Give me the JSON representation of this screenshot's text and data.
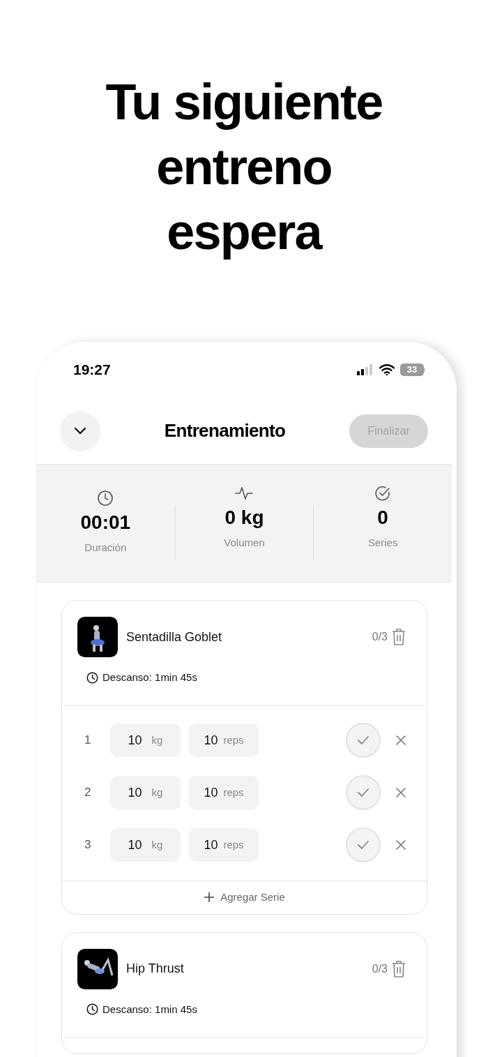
{
  "headline": "Tu siguiente entreno espera",
  "status_bar": {
    "time": "19:27",
    "battery": "33"
  },
  "header": {
    "title": "Entrenamiento",
    "finish_button": {
      "label": "Finalizar",
      "disabled": true
    }
  },
  "stats": [
    {
      "kind": "clock",
      "value": "00:01",
      "label": "Duración"
    },
    {
      "kind": "pulse",
      "value": "0 kg",
      "label": "Volumen"
    },
    {
      "kind": "check",
      "value": "0",
      "label": "Series"
    }
  ],
  "exercises": [
    {
      "name": "Sentadilla Goblet",
      "progress": "0/3",
      "rest": "Descanso: 1min 45s",
      "sets": [
        {
          "number": "1",
          "weight": "10",
          "weight_unit": "kg",
          "reps": "10",
          "reps_unit": "reps",
          "done": false
        },
        {
          "number": "2",
          "weight": "10",
          "weight_unit": "kg",
          "reps": "10",
          "reps_unit": "reps",
          "done": false
        },
        {
          "number": "3",
          "weight": "10",
          "weight_unit": "kg",
          "reps": "10",
          "reps_unit": "reps",
          "done": false
        }
      ],
      "add_set": "Agregar Serie"
    },
    {
      "name": "Hip Thrust",
      "progress": "0/3",
      "rest": "Descanso: 1min 45s"
    }
  ]
}
